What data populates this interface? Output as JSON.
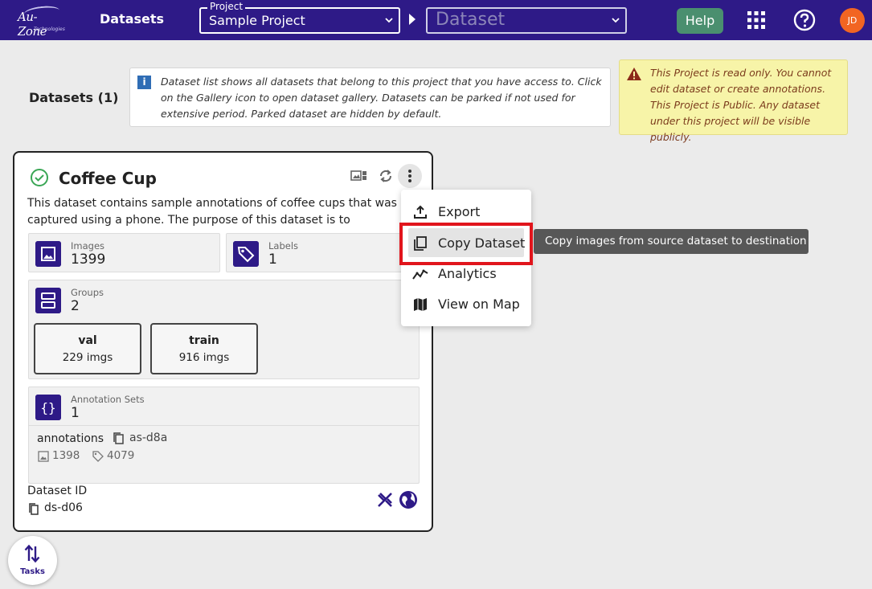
{
  "topbar": {
    "logo_text": "Au-Zone",
    "logo_sub": "Technologies",
    "title": "Datasets",
    "project_legend": "Project",
    "project_value": "Sample Project",
    "dataset_placeholder": "Dataset",
    "help_label": "Help",
    "avatar_initials": "JD",
    "brand_color": "#2e1a87",
    "avatar_color": "#f26522"
  },
  "header": {
    "datasets_count_label": "Datasets (1)",
    "info_text": "Dataset list shows all datasets that belong to this project that you have access to. Click on the Gallery icon to open dataset gallery. Datasets can be parked if not used for extensive period. Parked dataset are hidden by default.",
    "warning_text_1": "This Project is read only. You cannot edit dataset or create annotations.",
    "warning_text_2": "This Project is Public. Any dataset under this project will be visible publicly."
  },
  "card": {
    "title": "Coffee Cup",
    "status_icon": "check-circle-icon",
    "description": "This dataset contains sample annotations of coffee cups that was captured using a phone. The purpose of this dataset is to explore...",
    "images_label": "Images",
    "images_value": "1399",
    "labels_label": "Labels",
    "labels_value": "1",
    "groups_label": "Groups",
    "groups_value": "2",
    "groups": [
      {
        "name": "val",
        "count": "229 imgs"
      },
      {
        "name": "train",
        "count": "916 imgs"
      }
    ],
    "annotation_sets_label": "Annotation Sets",
    "annotation_sets_value": "1",
    "annotation_set": {
      "name": "annotations",
      "id": "as-d8a",
      "images": "1398",
      "labels": "4079"
    },
    "dataset_id_label": "Dataset ID",
    "dataset_id": "ds-d06"
  },
  "menu": {
    "items": [
      {
        "label": "Export",
        "icon": "export-icon"
      },
      {
        "label": "Copy Dataset",
        "icon": "copy-icon"
      },
      {
        "label": "Analytics",
        "icon": "analytics-icon"
      },
      {
        "label": "View on Map",
        "icon": "map-icon"
      }
    ]
  },
  "tooltip": {
    "text": "Copy images from source dataset to destination"
  },
  "tasks": {
    "label": "Tasks"
  }
}
